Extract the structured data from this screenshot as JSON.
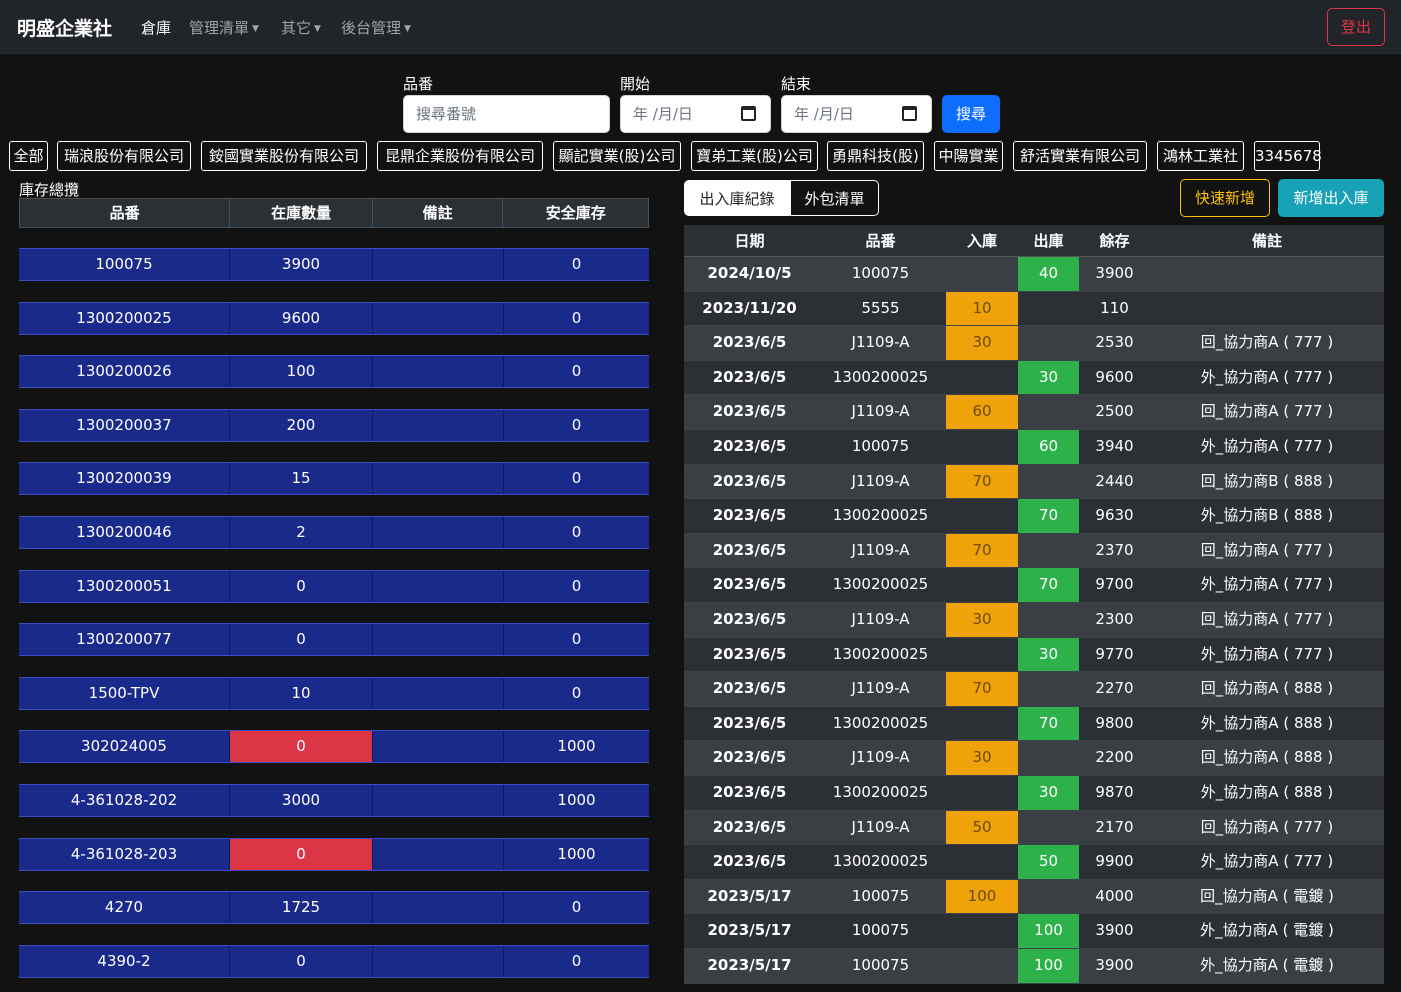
{
  "navbar": {
    "brand": "明盛企業社",
    "items": [
      {
        "label": "倉庫",
        "dropdown": false
      },
      {
        "label": "管理清單",
        "dropdown": true
      },
      {
        "label": "其它",
        "dropdown": true
      },
      {
        "label": "後台管理",
        "dropdown": true
      }
    ],
    "logout_label": "登出"
  },
  "search": {
    "part_label": "品番",
    "part_placeholder": "搜尋番號",
    "start_label": "開始",
    "start_placeholder": "年 /月/日",
    "end_label": "結束",
    "end_placeholder": "年 /月/日",
    "button_label": "搜尋"
  },
  "companies": [
    "全部",
    "瑞浪股份有限公司",
    "銨國實業股份有限公司",
    "昆鼎企業股份有限公司",
    "顯記實業(股)公司",
    "寶弟工業(股)公司",
    "勇鼎科技(股)",
    "中陽實業",
    "舒活實業有限公司",
    "鴻林工業社",
    "3345678"
  ],
  "inventory": {
    "title": "庫存總攬",
    "headers": [
      "品番",
      "在庫數量",
      "備註",
      "安全庫存"
    ],
    "rows": [
      {
        "part": "100075",
        "qty": "3900",
        "note": "",
        "safety": "0",
        "alert": false
      },
      {
        "part": "1300200025",
        "qty": "9600",
        "note": "",
        "safety": "0",
        "alert": false
      },
      {
        "part": "1300200026",
        "qty": "100",
        "note": "",
        "safety": "0",
        "alert": false
      },
      {
        "part": "1300200037",
        "qty": "200",
        "note": "",
        "safety": "0",
        "alert": false
      },
      {
        "part": "1300200039",
        "qty": "15",
        "note": "",
        "safety": "0",
        "alert": false
      },
      {
        "part": "1300200046",
        "qty": "2",
        "note": "",
        "safety": "0",
        "alert": false
      },
      {
        "part": "1300200051",
        "qty": "0",
        "note": "",
        "safety": "0",
        "alert": false
      },
      {
        "part": "1300200077",
        "qty": "0",
        "note": "",
        "safety": "0",
        "alert": false
      },
      {
        "part": "1500-TPV",
        "qty": "10",
        "note": "",
        "safety": "0",
        "alert": false
      },
      {
        "part": "302024005",
        "qty": "0",
        "note": "",
        "safety": "1000",
        "alert": true
      },
      {
        "part": "4-361028-202",
        "qty": "3000",
        "note": "",
        "safety": "1000",
        "alert": false
      },
      {
        "part": "4-361028-203",
        "qty": "0",
        "note": "",
        "safety": "1000",
        "alert": true
      },
      {
        "part": "4270",
        "qty": "1725",
        "note": "",
        "safety": "0",
        "alert": false
      },
      {
        "part": "4390-2",
        "qty": "0",
        "note": "",
        "safety": "0",
        "alert": false
      }
    ]
  },
  "records": {
    "tabs": [
      "出入庫紀錄",
      "外包清單"
    ],
    "quick_add_label": "快速新增",
    "new_io_label": "新增出入庫",
    "headers": [
      "日期",
      "品番",
      "入庫",
      "出庫",
      "餘存",
      "備註"
    ],
    "rows": [
      {
        "date": "2024/10/5",
        "part": "100075",
        "in": "",
        "out": "40",
        "balance": "3900",
        "note": ""
      },
      {
        "date": "2023/11/20",
        "part": "5555",
        "in": "10",
        "out": "",
        "balance": "110",
        "note": ""
      },
      {
        "date": "2023/6/5",
        "part": "J1109-A",
        "in": "30",
        "out": "",
        "balance": "2530",
        "note": "回_協力商A ( 777 )"
      },
      {
        "date": "2023/6/5",
        "part": "1300200025",
        "in": "",
        "out": "30",
        "balance": "9600",
        "note": "外_協力商A ( 777 )"
      },
      {
        "date": "2023/6/5",
        "part": "J1109-A",
        "in": "60",
        "out": "",
        "balance": "2500",
        "note": "回_協力商A ( 777 )"
      },
      {
        "date": "2023/6/5",
        "part": "100075",
        "in": "",
        "out": "60",
        "balance": "3940",
        "note": "外_協力商A ( 777 )"
      },
      {
        "date": "2023/6/5",
        "part": "J1109-A",
        "in": "70",
        "out": "",
        "balance": "2440",
        "note": "回_協力商B ( 888 )"
      },
      {
        "date": "2023/6/5",
        "part": "1300200025",
        "in": "",
        "out": "70",
        "balance": "9630",
        "note": "外_協力商B ( 888 )"
      },
      {
        "date": "2023/6/5",
        "part": "J1109-A",
        "in": "70",
        "out": "",
        "balance": "2370",
        "note": "回_協力商A ( 777 )"
      },
      {
        "date": "2023/6/5",
        "part": "1300200025",
        "in": "",
        "out": "70",
        "balance": "9700",
        "note": "外_協力商A ( 777 )"
      },
      {
        "date": "2023/6/5",
        "part": "J1109-A",
        "in": "30",
        "out": "",
        "balance": "2300",
        "note": "回_協力商A ( 777 )"
      },
      {
        "date": "2023/6/5",
        "part": "1300200025",
        "in": "",
        "out": "30",
        "balance": "9770",
        "note": "外_協力商A ( 777 )"
      },
      {
        "date": "2023/6/5",
        "part": "J1109-A",
        "in": "70",
        "out": "",
        "balance": "2270",
        "note": "回_協力商A ( 888 )"
      },
      {
        "date": "2023/6/5",
        "part": "1300200025",
        "in": "",
        "out": "70",
        "balance": "9800",
        "note": "外_協力商A ( 888 )"
      },
      {
        "date": "2023/6/5",
        "part": "J1109-A",
        "in": "30",
        "out": "",
        "balance": "2200",
        "note": "回_協力商A ( 888 )"
      },
      {
        "date": "2023/6/5",
        "part": "1300200025",
        "in": "",
        "out": "30",
        "balance": "9870",
        "note": "外_協力商A ( 888 )"
      },
      {
        "date": "2023/6/5",
        "part": "J1109-A",
        "in": "50",
        "out": "",
        "balance": "2170",
        "note": "回_協力商A ( 777 )"
      },
      {
        "date": "2023/6/5",
        "part": "1300200025",
        "in": "",
        "out": "50",
        "balance": "9900",
        "note": "外_協力商A ( 777 )"
      },
      {
        "date": "2023/5/17",
        "part": "100075",
        "in": "100",
        "out": "",
        "balance": "4000",
        "note": "回_協力商A ( 電鍍 )"
      },
      {
        "date": "2023/5/17",
        "part": "100075",
        "in": "",
        "out": "100",
        "balance": "3900",
        "note": "外_協力商A ( 電鍍 )"
      },
      {
        "date": "2023/5/17",
        "part": "100075",
        "in": "",
        "out": "100",
        "balance": "3900",
        "note": "外_協力商A ( 電鍍 )"
      }
    ]
  },
  "colors": {
    "page_bg": "#121212",
    "navbar_bg": "#212529",
    "inventory_row": "#1a2a8a",
    "low_stock": "#dc3545",
    "in_stock_cell": "#f0a20a",
    "out_stock_cell": "#2db14a",
    "primary": "#0d6efd",
    "info": "#17a2b8",
    "warning": "#ffc107"
  }
}
